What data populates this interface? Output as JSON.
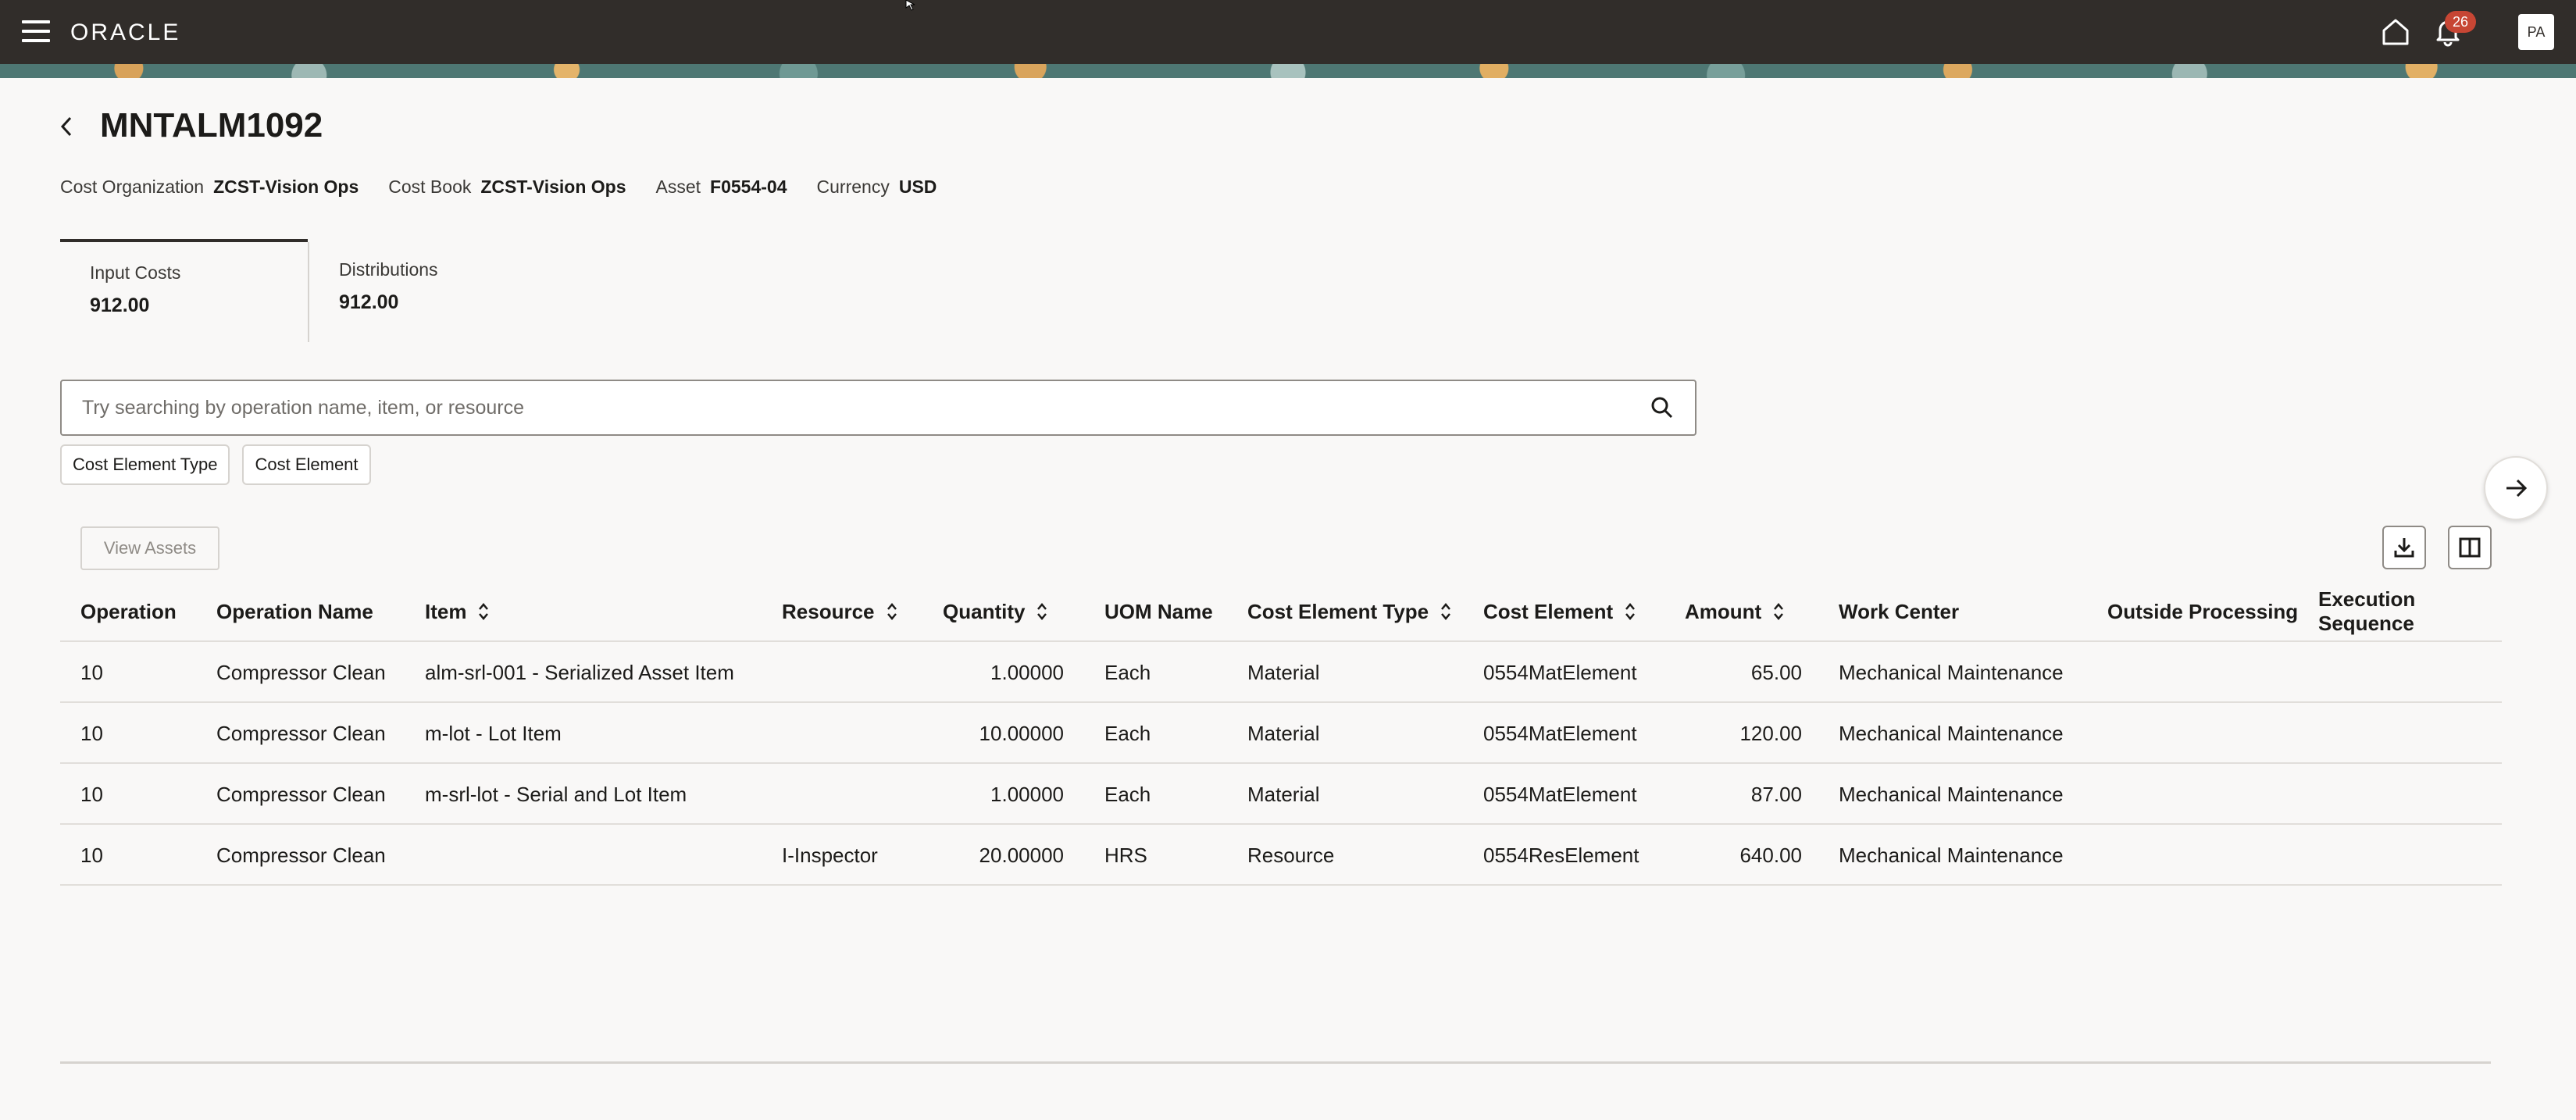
{
  "header": {
    "brand": "ORACLE",
    "notification_count": "26",
    "avatar_initials": "PA"
  },
  "page": {
    "title": "MNTALM1092",
    "meta": [
      {
        "label": "Cost Organization",
        "value": "ZCST-Vision Ops"
      },
      {
        "label": "Cost Book",
        "value": "ZCST-Vision Ops"
      },
      {
        "label": "Asset",
        "value": "F0554-04"
      },
      {
        "label": "Currency",
        "value": "USD"
      }
    ]
  },
  "summary_tabs": [
    {
      "label": "Input Costs",
      "value": "912.00",
      "selected": true
    },
    {
      "label": "Distributions",
      "value": "912.00",
      "selected": false
    }
  ],
  "search": {
    "placeholder": "Try searching by operation name, item, or resource",
    "value": ""
  },
  "filters": [
    "Cost Element Type",
    "Cost Element"
  ],
  "toolbar": {
    "view_assets_label": "View Assets"
  },
  "table": {
    "columns": [
      {
        "label": "Operation",
        "sortable": false
      },
      {
        "label": "Operation Name",
        "sortable": false
      },
      {
        "label": "Item",
        "sortable": true
      },
      {
        "label": "Resource",
        "sortable": true
      },
      {
        "label": "Quantity",
        "sortable": true
      },
      {
        "label": "UOM Name",
        "sortable": false
      },
      {
        "label": "Cost Element Type",
        "sortable": true
      },
      {
        "label": "Cost Element",
        "sortable": true
      },
      {
        "label": "Amount",
        "sortable": true
      },
      {
        "label": "Work Center",
        "sortable": false
      },
      {
        "label": "Outside Processing",
        "sortable": false
      },
      {
        "label": "Execution Sequence",
        "sortable": false
      }
    ],
    "rows": [
      [
        "10",
        "Compressor Clean",
        "alm-srl-001 - Serialized Asset Item",
        "",
        "1.00000",
        "Each",
        "Material",
        "0554MatElement",
        "65.00",
        "Mechanical Maintenance",
        "",
        ""
      ],
      [
        "10",
        "Compressor Clean",
        "m-lot - Lot Item",
        "",
        "10.00000",
        "Each",
        "Material",
        "0554MatElement",
        "120.00",
        "Mechanical Maintenance",
        "",
        ""
      ],
      [
        "10",
        "Compressor Clean",
        "m-srl-lot - Serial and Lot Item",
        "",
        "1.00000",
        "Each",
        "Material",
        "0554MatElement",
        "87.00",
        "Mechanical Maintenance",
        "",
        ""
      ],
      [
        "10",
        "Compressor Clean",
        "",
        "I-Inspector",
        "20.00000",
        "HRS",
        "Resource",
        "0554ResElement",
        "640.00",
        "Mechanical Maintenance",
        "",
        ""
      ]
    ]
  },
  "colors": {
    "topbar": "#312d2a",
    "badge": "#c74634",
    "page_bg": "#f9f8f7"
  },
  "icons": [
    "hamburger-icon",
    "home-icon",
    "bell-icon",
    "back-chevron-icon",
    "search-icon",
    "arrow-right-icon",
    "sort-icon",
    "download-icon",
    "columns-icon"
  ]
}
